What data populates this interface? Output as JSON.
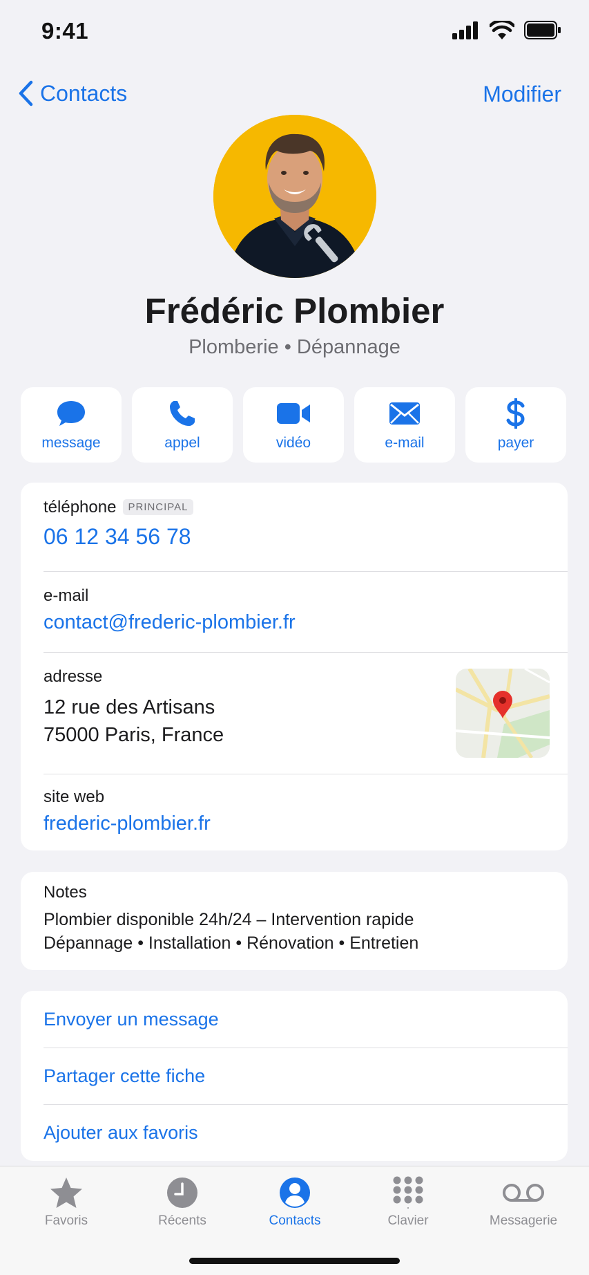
{
  "status_bar": {
    "time": "9:41"
  },
  "nav": {
    "back_label": "Contacts",
    "edit_label": "Modifier"
  },
  "contact": {
    "name": "Frédéric Plombier",
    "subtitle": "Plomberie • Dépannage"
  },
  "actions": [
    {
      "icon": "message-bubble-icon",
      "label": "message"
    },
    {
      "icon": "phone-icon",
      "label": "appel"
    },
    {
      "icon": "video-camera-icon",
      "label": "vidéo"
    },
    {
      "icon": "envelope-icon",
      "label": "e-mail"
    },
    {
      "icon": "dollar-icon",
      "label": "payer"
    }
  ],
  "details": {
    "phone": {
      "label": "téléphone",
      "tag": "PRINCIPAL",
      "value": "06 12 34 56 78"
    },
    "email": {
      "label": "e-mail",
      "value": "contact@frederic-plombier.fr"
    },
    "address": {
      "label": "adresse",
      "line1": "12 rue des Artisans",
      "line2": "75000 Paris, France"
    },
    "website": {
      "label": "site web",
      "value": "frederic-plombier.fr"
    }
  },
  "notes": {
    "label": "Notes",
    "line1": "Plombier disponible 24h/24 – Intervention rapide",
    "line2": "Dépannage • Installation • Rénovation • Entretien"
  },
  "links": [
    "Envoyer un message",
    "Partager cette fiche",
    "Ajouter aux favoris"
  ],
  "tabs": [
    {
      "icon": "star-icon",
      "label": "Favoris",
      "active": false
    },
    {
      "icon": "clock-icon",
      "label": "Récents",
      "active": false
    },
    {
      "icon": "person-circle-icon",
      "label": "Contacts",
      "active": true
    },
    {
      "icon": "keypad-icon",
      "label": "Clavier",
      "active": false
    },
    {
      "icon": "voicemail-icon",
      "label": "Messagerie",
      "active": false
    }
  ],
  "colors": {
    "accent": "#1a73e8",
    "background": "#f2f2f6",
    "avatar_bg": "#f6b800"
  }
}
